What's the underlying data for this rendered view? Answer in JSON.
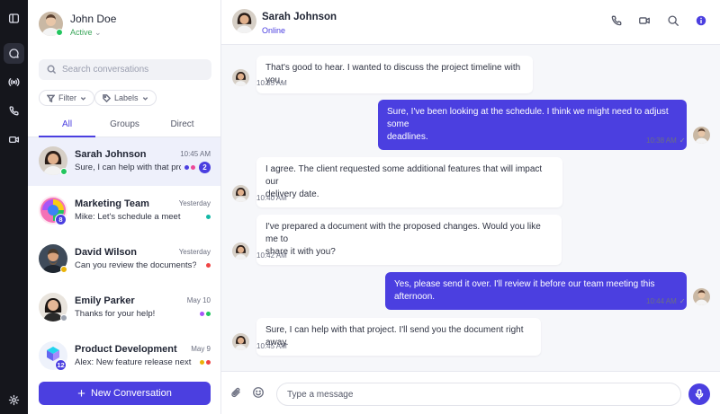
{
  "colors": {
    "accent": "#4b3fe0",
    "online": "#22c55e",
    "away": "#eab308",
    "offline": "#9ca3af",
    "rail": "#15161c"
  },
  "rail": {
    "items": [
      {
        "icon": "sidebar-toggle-icon"
      },
      {
        "icon": "chat-icon",
        "active": true
      },
      {
        "icon": "broadcast-icon"
      },
      {
        "icon": "phone-icon"
      },
      {
        "icon": "video-icon"
      },
      {
        "icon": "settings-icon"
      }
    ]
  },
  "user": {
    "name": "John Doe",
    "status": "Active",
    "status_chevron": "⌄"
  },
  "search": {
    "placeholder": "Search conversations"
  },
  "filters": {
    "filter_label": "Filter",
    "labels_label": "Labels"
  },
  "tabs": [
    {
      "label": "All",
      "active": true
    },
    {
      "label": "Groups"
    },
    {
      "label": "Direct"
    }
  ],
  "conversations": [
    {
      "name": "Sarah Johnson",
      "time": "10:45 AM",
      "preview": "Sure, I can help with that project...",
      "unread": "2",
      "status": "online",
      "dots": [
        "#4b3fe0",
        "#ec4899"
      ]
    },
    {
      "name": "Marketing Team",
      "time": "Yesterday",
      "preview": "Mike: Let's schedule a meeting",
      "group_count": "8",
      "dots": [
        "#14b8a6"
      ]
    },
    {
      "name": "David Wilson",
      "time": "Yesterday",
      "preview": "Can you review the documents?",
      "status": "away",
      "dots": [
        "#ef4444"
      ]
    },
    {
      "name": "Emily Parker",
      "time": "May 10",
      "preview": "Thanks for your help!",
      "status": "offline",
      "dots": [
        "#a855f7",
        "#22c55e"
      ]
    },
    {
      "name": "Product Development",
      "time": "May 9",
      "preview": "Alex: New feature release next week",
      "group_count": "12",
      "dots": [
        "#eab308",
        "#ef4444"
      ]
    }
  ],
  "new_conversation_label": "New Conversation",
  "chat": {
    "contact_name": "Sarah Johnson",
    "contact_status": "Online",
    "messages": [
      {
        "dir": "in",
        "lines": [
          "That's good to hear. I wanted to discuss the project timeline with you."
        ],
        "time": "10:35 AM"
      },
      {
        "dir": "out",
        "lines": [
          "Sure, I've been looking at the schedule. I think we might need to adjust some",
          "deadlines."
        ],
        "time": "10:38 AM",
        "check": "✓"
      },
      {
        "dir": "in",
        "lines": [
          "I agree. The client requested some additional features that will impact our",
          "delivery date."
        ],
        "time": "10:40 AM"
      },
      {
        "dir": "in",
        "lines": [
          "I've prepared a document with the proposed changes. Would you like me to",
          "share it with you?"
        ],
        "time": "10:42 AM"
      },
      {
        "dir": "out",
        "lines": [
          "Yes, please send it over. I'll review it before our team meeting this afternoon."
        ],
        "time": "10:44 AM",
        "check": "✓"
      },
      {
        "dir": "in",
        "lines": [
          "Sure, I can help with that project. I'll send you the document right away."
        ],
        "time": "10:45 AM"
      }
    ],
    "composer_placeholder": "Type a message"
  }
}
